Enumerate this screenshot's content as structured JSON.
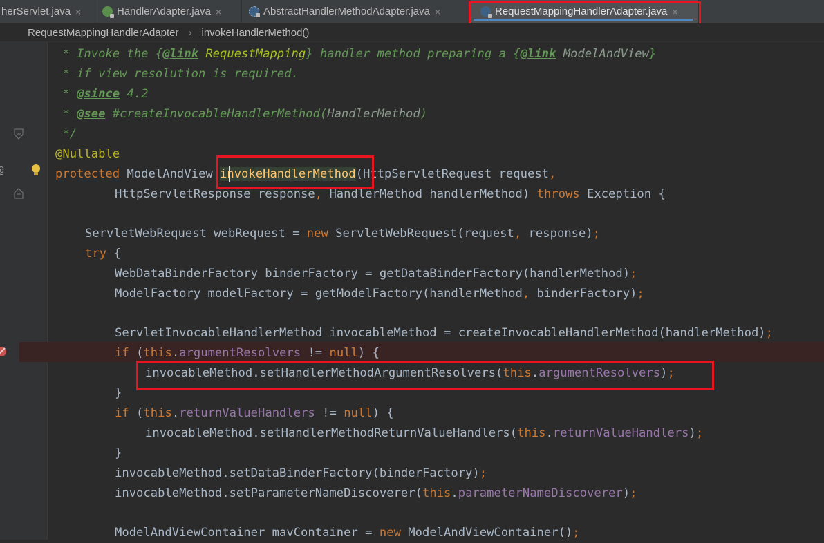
{
  "tabs": [
    {
      "label": "herServlet.java",
      "icon": "none",
      "active": false
    },
    {
      "label": "HandlerAdapter.java",
      "icon": "interface-icon",
      "active": false
    },
    {
      "label": "AbstractHandlerMethodAdapter.java",
      "icon": "abstract-class-icon",
      "active": false
    },
    {
      "label": "RequestMappingHandlerAdapter.java",
      "icon": "class-icon",
      "active": true
    }
  ],
  "tab_close_glyph": "×",
  "breadcrumb": {
    "items": [
      "RequestMappingHandlerAdapter",
      "invokeHandlerMethod()"
    ],
    "separator": "›"
  },
  "colors": {
    "keyword": "#cc7832",
    "field": "#9876aa",
    "annotation": "#bbb529",
    "doc": "#629755",
    "highlight_box": "#e8141f",
    "active_tab_underline": "#4a88c7"
  },
  "code": {
    "line_1": {
      "a": " * Invoke the {",
      "b": "@link",
      "c": " RequestMapping",
      "d": "} handler method preparing a {",
      "e": "@link",
      "f": " ModelAndView",
      "g": "}"
    },
    "line_2": " * if view resolution is required.",
    "line_3": {
      "a": " * ",
      "b": "@since",
      "c": " 4.2"
    },
    "line_4": {
      "a": " * ",
      "b": "@see",
      "c": " #createInvocableHandlerMethod(",
      "d": "HandlerMethod",
      "e": ")"
    },
    "line_5": " */",
    "line_6": "@Nullable",
    "line_7": {
      "kw": "protected",
      "a": " ModelAndView ",
      "method": "invokeHandlerMethod",
      "b": "(HttpServletRequest request",
      "c": ","
    },
    "line_8": {
      "a": "HttpServletResponse response",
      "b": ",",
      "c": " HandlerMethod handlerMethod) ",
      "kw": "throws",
      "d": " Exception {"
    },
    "line_10": {
      "a": "ServletWebRequest webRequest = ",
      "kw": "new",
      "b": " ServletWebRequest(request",
      "c": ",",
      "d": " response)",
      "e": ";"
    },
    "line_11": {
      "kw": "try",
      "a": " {"
    },
    "line_12": {
      "a": "WebDataBinderFactory binderFactory = getDataBinderFactory(handlerMethod)",
      "b": ";"
    },
    "line_13": {
      "a": "ModelFactory modelFactory = getModelFactory(handlerMethod",
      "b": ",",
      "c": " binderFactory)",
      "d": ";"
    },
    "line_15": {
      "a": "ServletInvocableHandlerMethod invocableMethod = createInvocableHandlerMethod(handlerMethod)",
      "b": ";"
    },
    "line_16": {
      "kw": "if",
      "a": " (",
      "kw2": "this",
      "b": ".",
      "fld": "argumentResolvers",
      "c": " != ",
      "kw3": "null",
      "d": ") {"
    },
    "line_17": {
      "a": "invocableMethod.setHandlerMethodArgumentResolvers(",
      "kw": "this",
      "b": ".",
      "fld": "argumentResolvers",
      "c": ")",
      "d": ";"
    },
    "line_18": "}",
    "line_19": {
      "kw": "if",
      "a": " (",
      "kw2": "this",
      "b": ".",
      "fld": "returnValueHandlers",
      "c": " != ",
      "kw3": "null",
      "d": ") {"
    },
    "line_20": {
      "a": "invocableMethod.setHandlerMethodReturnValueHandlers(",
      "kw": "this",
      "b": ".",
      "fld": "returnValueHandlers",
      "c": ")",
      "d": ";"
    },
    "line_21": "}",
    "line_22": {
      "a": "invocableMethod.setDataBinderFactory(binderFactory)",
      "b": ";"
    },
    "line_23": {
      "a": "invocableMethod.setParameterNameDiscoverer(",
      "kw": "this",
      "b": ".",
      "fld": "parameterNameDiscoverer",
      "c": ")",
      "d": ";"
    },
    "line_25": {
      "a": "ModelAndViewContainer mavContainer = ",
      "kw": "new",
      "b": " ModelAndViewContainer()",
      "c": ";"
    }
  },
  "gutter": {
    "override_marker": "@"
  }
}
